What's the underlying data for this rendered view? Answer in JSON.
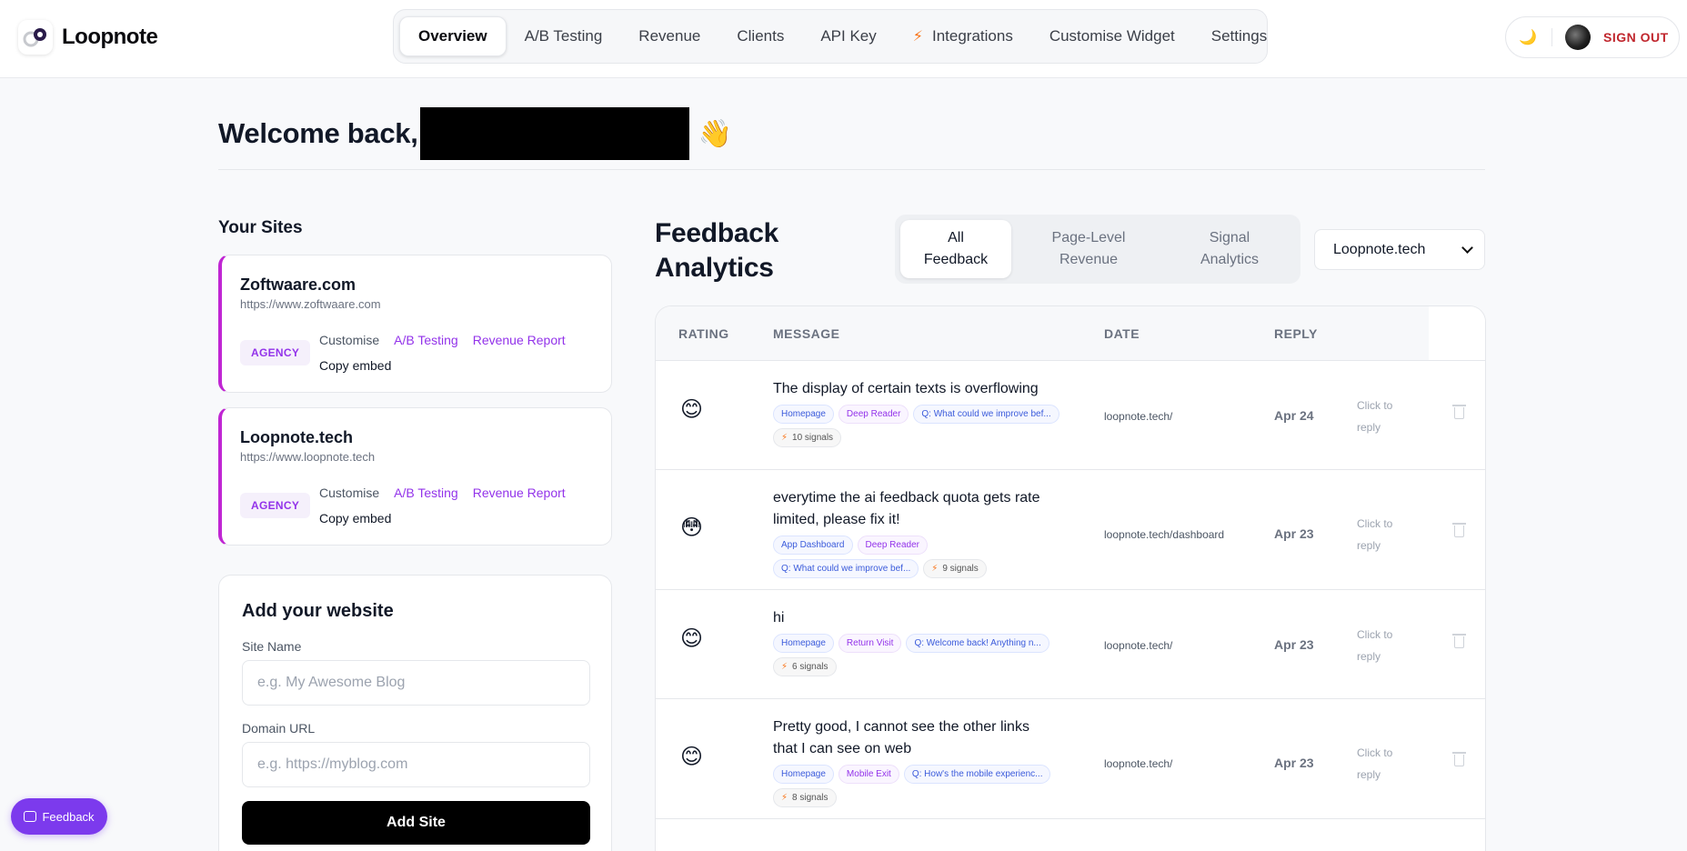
{
  "app": {
    "name": "Loopnote"
  },
  "nav": [
    {
      "label": "Overview",
      "active": true
    },
    {
      "label": "A/B Testing"
    },
    {
      "label": "Revenue"
    },
    {
      "label": "Clients"
    },
    {
      "label": "API Key"
    },
    {
      "label": "Integrations",
      "icon": "bolt-icon"
    },
    {
      "label": "Customise Widget"
    },
    {
      "label": "Settings"
    }
  ],
  "user": {
    "signout_label": "SIGN OUT",
    "theme_icon": "moon-icon"
  },
  "welcome": {
    "text": "Welcome back,",
    "emoji": "👋"
  },
  "sites": {
    "title": "Your Sites",
    "items": [
      {
        "name": "Zoftwaare.com",
        "url": "https://www.zoftwaare.com",
        "badge": "AGENCY",
        "customise": "Customise",
        "ab": "A/B Testing",
        "revenue": "Revenue Report",
        "copy": "Copy embed"
      },
      {
        "name": "Loopnote.tech",
        "url": "https://www.loopnote.tech",
        "badge": "AGENCY",
        "customise": "Customise",
        "ab": "A/B Testing",
        "revenue": "Revenue Report",
        "copy": "Copy embed"
      }
    ]
  },
  "add_site": {
    "title": "Add your website",
    "site_name_label": "Site Name",
    "site_name_placeholder": "e.g. My Awesome Blog",
    "domain_label": "Domain URL",
    "domain_placeholder": "e.g. https://myblog.com",
    "button": "Add Site"
  },
  "feedback_button": "Feedback",
  "analytics": {
    "title_line1": "Feedback",
    "title_line2": "Analytics",
    "tabs": [
      {
        "line1": "All",
        "line2": "Feedback",
        "active": true
      },
      {
        "line1": "Page-Level",
        "line2": "Revenue"
      },
      {
        "line1": "Signal",
        "line2": "Analytics"
      }
    ],
    "selected_site": "Loopnote.tech",
    "columns": [
      "RATING",
      "MESSAGE",
      "DATE",
      "REPLY"
    ],
    "rows": [
      {
        "emoji": "😊",
        "message": "The display of certain texts is overflowing",
        "tags": [
          "Homepage",
          "Deep Reader",
          "Q: What could we improve bef...",
          "10 signals"
        ],
        "path": "loopnote.tech/",
        "date": "Apr 24",
        "reply1": "Click to",
        "reply2": "reply"
      },
      {
        "emoji": "😳",
        "message": "everytime the ai feedback quota gets rate limited, please fix it!",
        "tags": [
          "App Dashboard",
          "Deep Reader",
          "Q: What could we improve bef...",
          "9 signals"
        ],
        "path": "loopnote.tech/dashboard",
        "date": "Apr 23",
        "reply1": "Click to",
        "reply2": "reply"
      },
      {
        "emoji": "😊",
        "message": "hi",
        "tags": [
          "Homepage",
          "Return Visit",
          "Q: Welcome back! Anything n...",
          "6 signals"
        ],
        "path": "loopnote.tech/",
        "date": "Apr 23",
        "reply1": "Click to",
        "reply2": "reply"
      },
      {
        "emoji": "😊",
        "message": "Pretty good, I cannot see the other links that I can see on web",
        "tags": [
          "Homepage",
          "Mobile Exit",
          "Q: How's the mobile experienc...",
          "8 signals"
        ],
        "path": "loopnote.tech/",
        "date": "Apr 23",
        "reply1": "Click to",
        "reply2": "reply"
      }
    ]
  }
}
